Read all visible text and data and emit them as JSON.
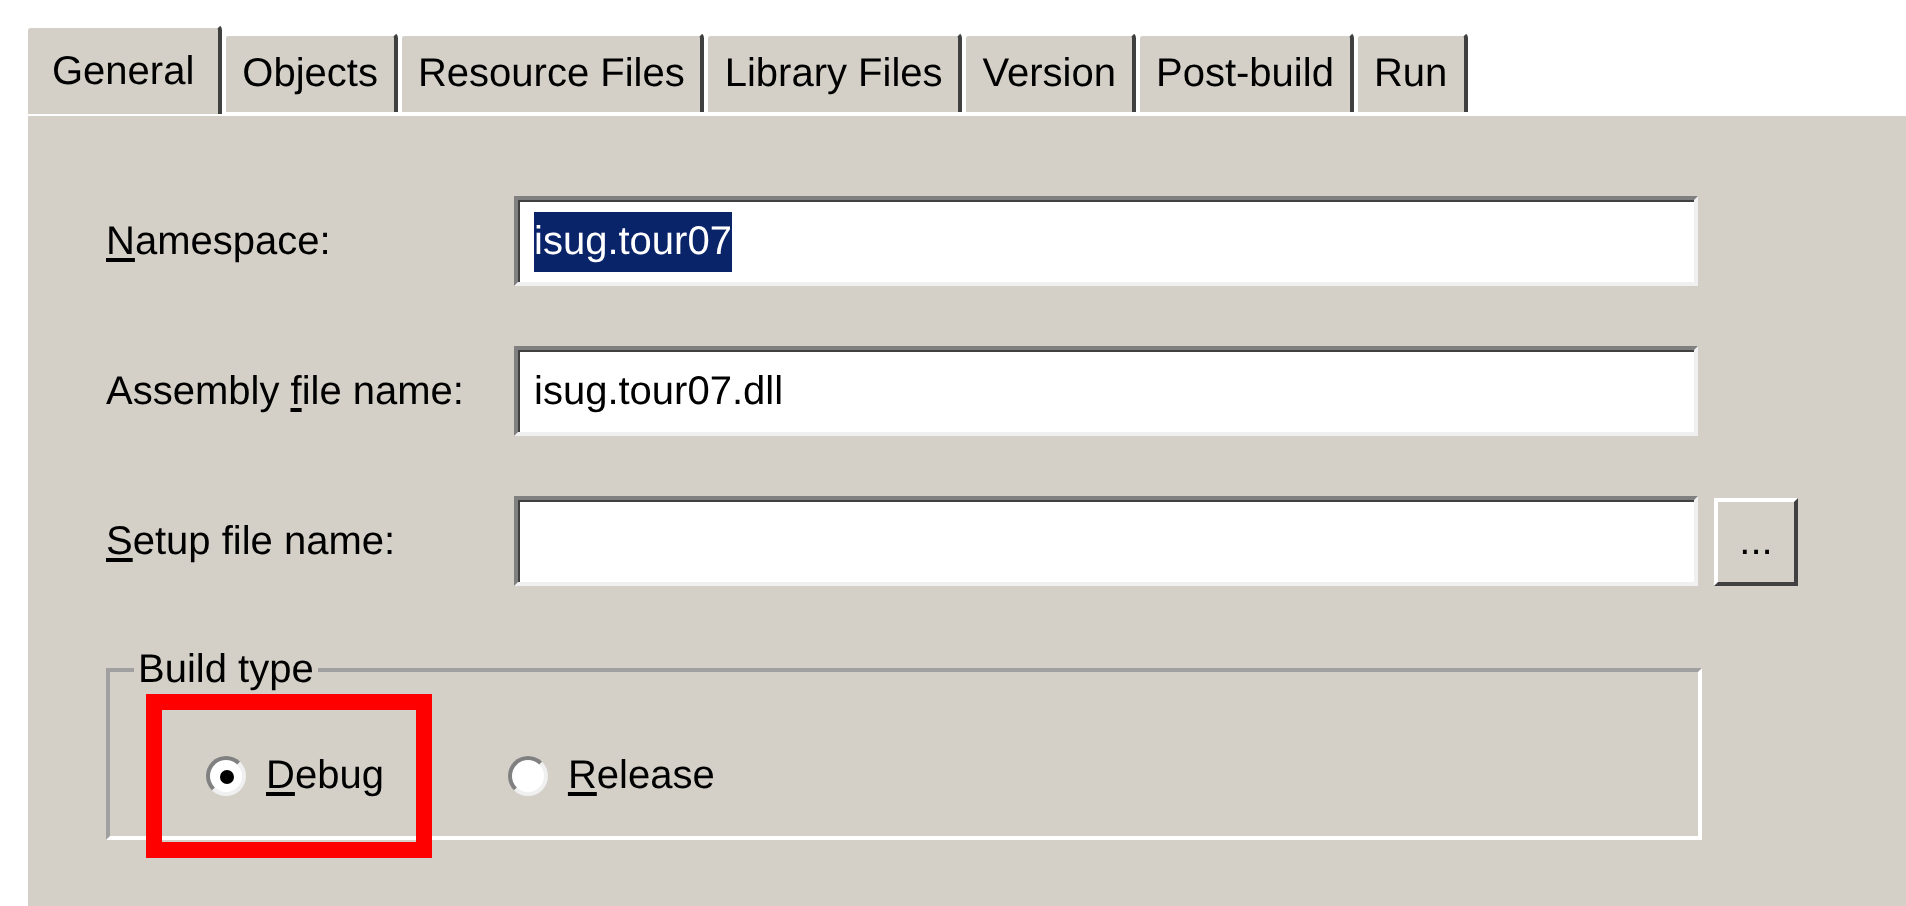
{
  "tabs": [
    {
      "label": "General",
      "selected": true
    },
    {
      "label": "Objects",
      "selected": false
    },
    {
      "label": "Resource Files",
      "selected": false
    },
    {
      "label": "Library Files",
      "selected": false
    },
    {
      "label": "Version",
      "selected": false
    },
    {
      "label": "Post-build",
      "selected": false
    },
    {
      "label": "Run",
      "selected": false
    }
  ],
  "fields": [
    {
      "label": {
        "access_key": "N",
        "after": "amespace:"
      },
      "value": "isug.tour07",
      "value_selected": true
    },
    {
      "label": {
        "before": "Assembly ",
        "access_key": "f",
        "after": "ile name:"
      },
      "value": "isug.tour07.dll",
      "value_selected": false
    },
    {
      "label": {
        "access_key": "S",
        "after": "etup file name:"
      },
      "browse_button": "..."
    }
  ],
  "build_type": {
    "title": "Build type",
    "options": [
      {
        "label": {
          "access_key": "D",
          "after": "ebug"
        },
        "selected": true,
        "highlighted": true
      },
      {
        "label": {
          "access_key": "R",
          "after": "elease"
        },
        "selected": false,
        "highlighted": false
      }
    ]
  }
}
